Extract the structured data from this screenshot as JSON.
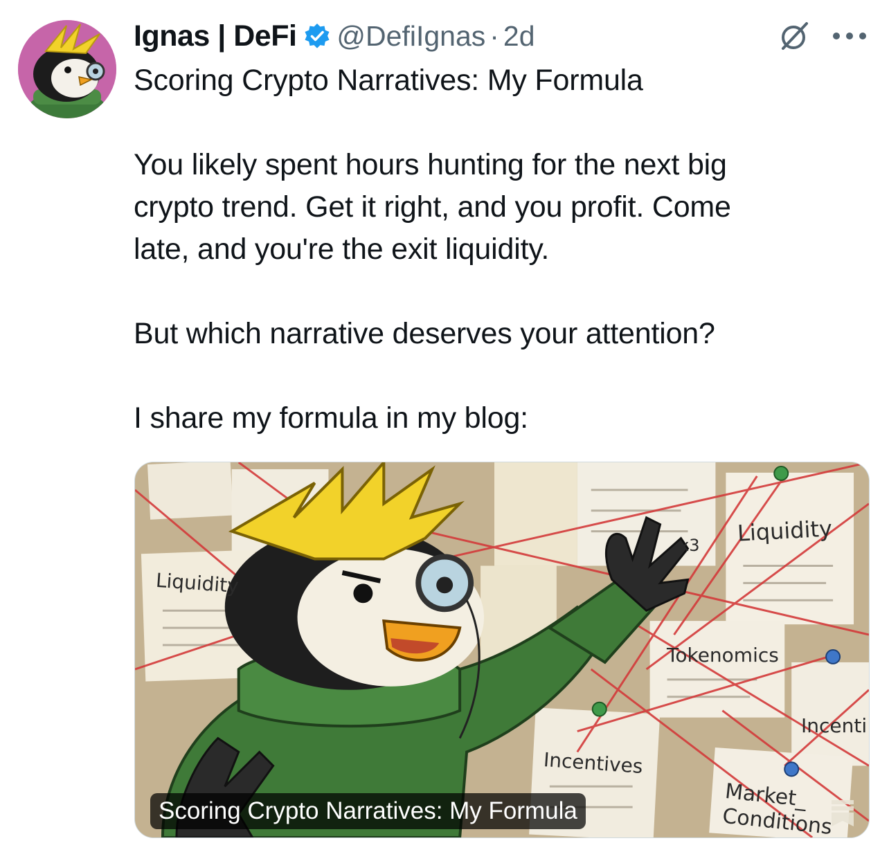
{
  "author": {
    "display_name": "Ignas | DeFi",
    "handle": "@DefiIgnas",
    "separator": "·",
    "time_ago": "2d",
    "verified": true,
    "avatar_colors": {
      "background": "#c665a9",
      "hair": "#f2d22a",
      "sweater": "#3d7a3a"
    }
  },
  "tweet": {
    "title": "Scoring Crypto Narratives: My Formula",
    "paragraph_1": "You likely spent hours hunting for the next big\ncrypto trend. Get it right, and you profit. Come\nlate, and you're the exit liquidity.",
    "paragraph_2": "But which narrative deserves your attention?",
    "paragraph_3": "I share my formula in my blog:"
  },
  "card": {
    "caption": "Scoring Crypto Narratives: My Formula",
    "notes": {
      "liquidity_left": "Liquidity",
      "liquidity_right": "Liquidity",
      "multiplier": "x3",
      "tokenomics": "Tokenomics",
      "incentives_bottom": "Incentives",
      "incentives_right": "Incenti",
      "market_conditions": "Market_\nConditions"
    }
  },
  "icons": {
    "verified": "verified-badge-icon",
    "grok": "grok-icon",
    "more": "more-options-icon"
  },
  "colors": {
    "text_primary": "#0f1419",
    "text_secondary": "#536471",
    "verified_blue": "#1d9bf0"
  }
}
